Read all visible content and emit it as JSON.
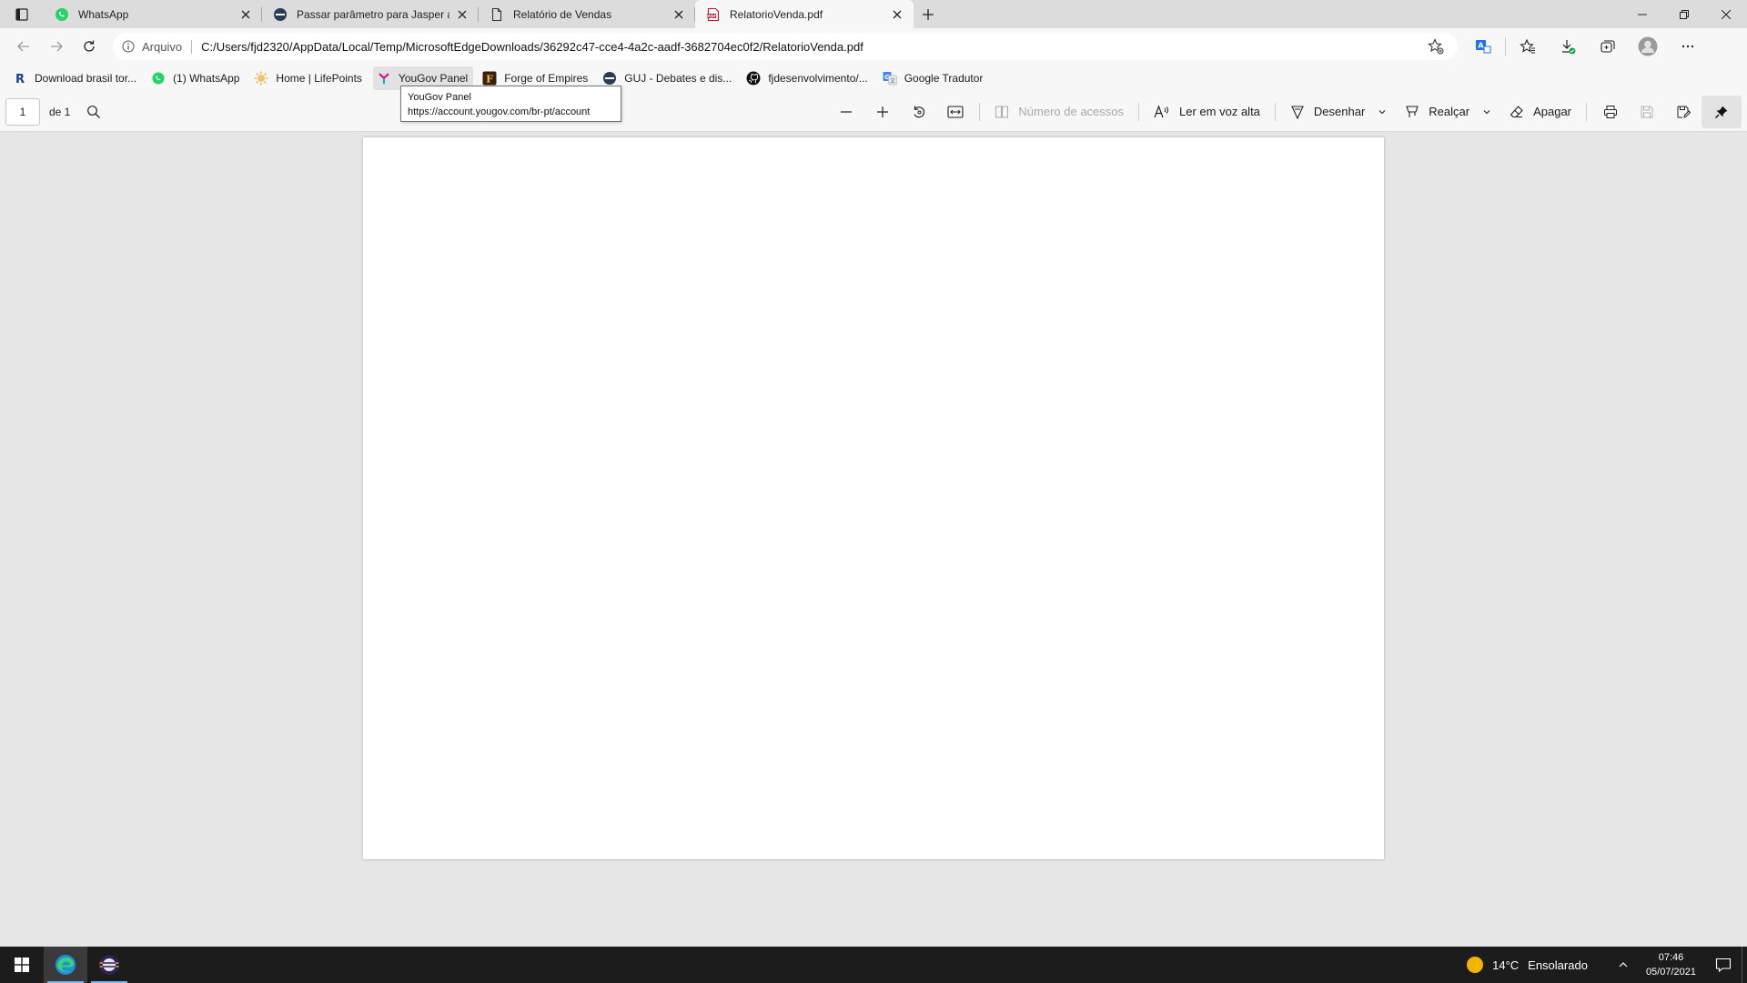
{
  "tabs": [
    {
      "title": "WhatsApp",
      "icon": "whatsapp-icon",
      "active": false
    },
    {
      "title": "Passar parâmetro para Jasper através...",
      "icon": "guj-icon",
      "active": false
    },
    {
      "title": "Relatório de Vendas",
      "icon": "document-icon",
      "active": false
    },
    {
      "title": "RelatorioVenda.pdf",
      "icon": "pdf-icon",
      "active": true
    }
  ],
  "address": {
    "scheme_label": "Arquivo",
    "url": "C:/Users/fjd2320/AppData/Local/Temp/MicrosoftEdgeDownloads/36292c47-cce4-4a2c-aadf-3682704ec0f2/RelatorioVenda.pdf"
  },
  "favorites": [
    {
      "label": "Download brasil tor...",
      "icon": "r-logo-icon"
    },
    {
      "label": "(1) WhatsApp",
      "icon": "whatsapp-icon"
    },
    {
      "label": "Home | LifePoints",
      "icon": "lifepoints-icon"
    },
    {
      "label": "YouGov Panel",
      "icon": "yougov-icon"
    },
    {
      "label": "Forge of Empires",
      "icon": "forge-of-empires-icon"
    },
    {
      "label": "GUJ - Debates e dis...",
      "icon": "guj-icon"
    },
    {
      "label": "fjdesenvolvimento/...",
      "icon": "github-icon"
    },
    {
      "label": "Google Tradutor",
      "icon": "google-translate-icon"
    }
  ],
  "tooltip": {
    "title": "YouGov Panel",
    "url": "https://account.yougov.com/br-pt/account"
  },
  "pdf_toolbar": {
    "page_number": "1",
    "page_count": "de 1",
    "access_count": "Número de acessos",
    "read_aloud": "Ler em voz alta",
    "draw": "Desenhar",
    "highlight": "Realçar",
    "erase": "Apagar"
  },
  "taskbar": {
    "weather_temp": "14°C",
    "weather_desc": "Ensolarado",
    "time": "07:46",
    "date": "05/07/2021"
  },
  "colors": {
    "accent": "#0078d4",
    "whatsapp": "#25d366",
    "pdf_red": "#c8102e",
    "sun": "#f4b400",
    "taskbar": "#1c1c1c"
  }
}
